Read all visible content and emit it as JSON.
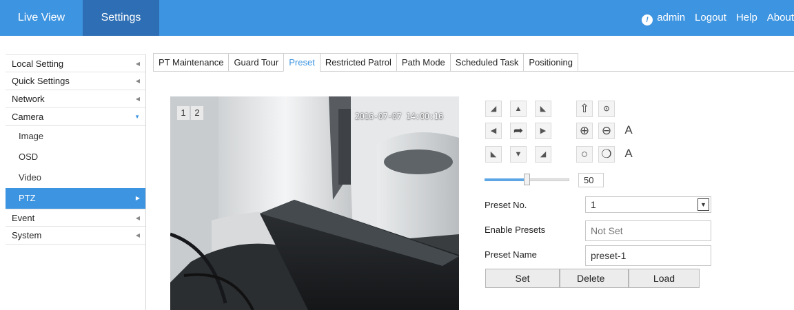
{
  "topnav": {
    "live_view": "Live View",
    "settings": "Settings",
    "user": "admin",
    "logout": "Logout",
    "help": "Help",
    "about": "About"
  },
  "sidebar": {
    "local_setting": "Local Setting",
    "quick_settings": "Quick Settings",
    "network": "Network",
    "camera": "Camera",
    "image": "Image",
    "osd": "OSD",
    "video": "Video",
    "ptz": "PTZ",
    "event": "Event",
    "system": "System"
  },
  "tabs": {
    "pt_maintenance": "PT Maintenance",
    "guard_tour": "Guard Tour",
    "preset": "Preset",
    "restricted_patrol": "Restricted Patrol",
    "path_mode": "Path Mode",
    "scheduled_task": "Scheduled Task",
    "positioning": "Positioning"
  },
  "video": {
    "window_1": "1",
    "window_2": "2",
    "timestamp": "2016-07-07 14:00:16"
  },
  "ptz": {
    "speed_value": "50",
    "speed_fraction": 0.5,
    "auto_focus_label": "A",
    "auto_iris_label": "A"
  },
  "preset_form": {
    "preset_no_label": "Preset No.",
    "preset_no_value": "1",
    "enable_presets_label": "Enable Presets",
    "enable_presets_value": "Not Set",
    "preset_name_label": "Preset Name",
    "preset_name_value": "preset-1"
  },
  "actions": {
    "set": "Set",
    "delete": "Delete",
    "load": "Load"
  },
  "colors": {
    "accent": "#3d94e0",
    "active_nav": "#2e6eb4"
  }
}
